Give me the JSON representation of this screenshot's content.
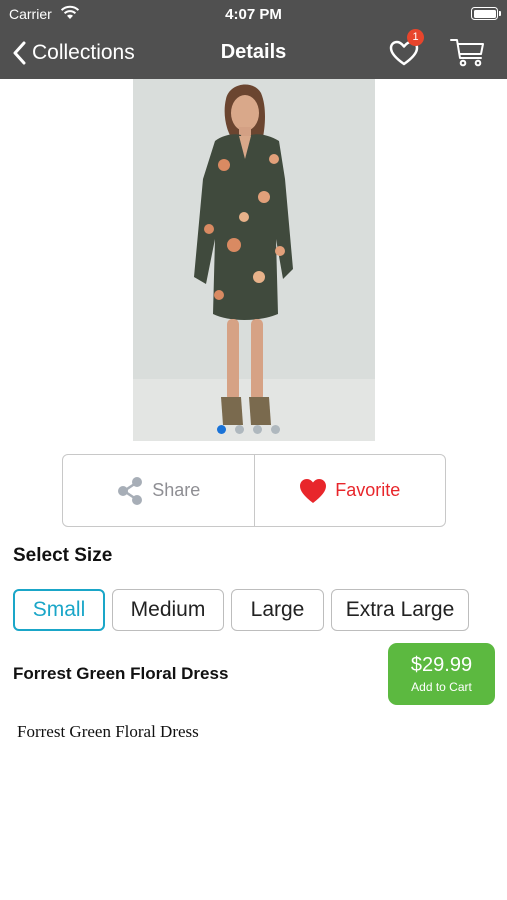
{
  "status_bar": {
    "carrier": "Carrier",
    "time": "4:07 PM"
  },
  "nav": {
    "back_label": "Collections",
    "title": "Details",
    "favorites_badge": "1",
    "background": "#505050"
  },
  "gallery": {
    "image_subject": "woman in forest green floral dress",
    "page_count": 4,
    "active_page": 1
  },
  "actions": {
    "share_label": "Share",
    "favorite_label": "Favorite",
    "favorite_color": "#e8262b"
  },
  "size": {
    "heading": "Select Size",
    "options": [
      "Small",
      "Medium",
      "Large",
      "Extra Large"
    ],
    "selected": "Small",
    "accent_color": "#1aa6c8"
  },
  "product": {
    "name": "Forrest Green Floral Dress",
    "price": "$29.99",
    "add_to_cart": "Add to Cart",
    "cart_button_color": "#5cb940",
    "description": "Forrest Green Floral Dress"
  }
}
